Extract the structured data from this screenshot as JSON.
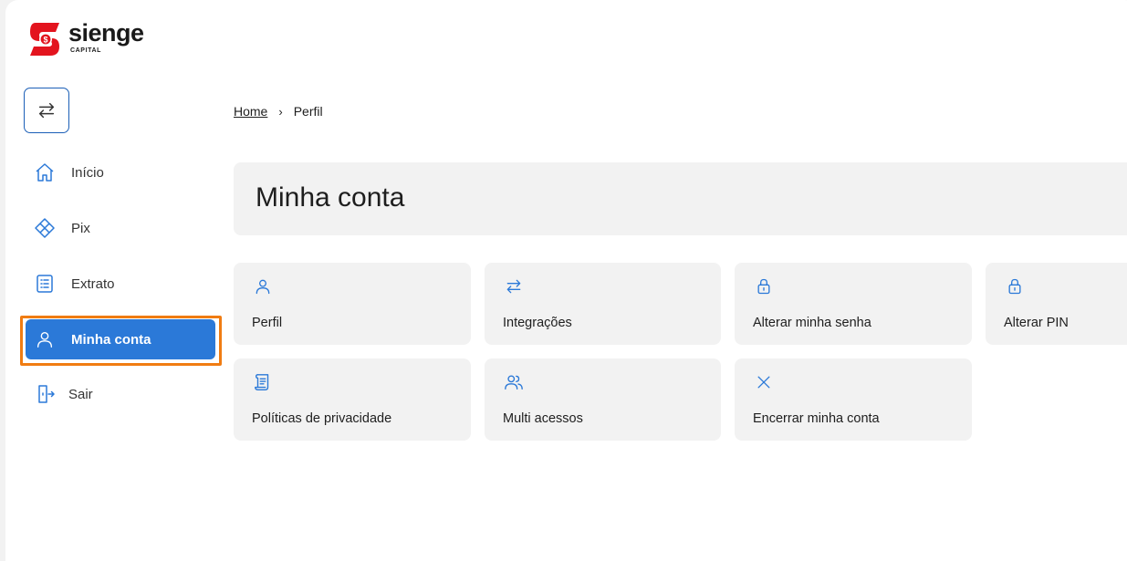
{
  "brand": {
    "name": "sienge",
    "sub": "CAPITAL",
    "color": "#e3141e"
  },
  "colors": {
    "accent": "#2b79d8",
    "highlight": "#f07c12"
  },
  "sidebar": {
    "items": [
      {
        "label": "Início",
        "icon": "home-icon"
      },
      {
        "label": "Pix",
        "icon": "pix-icon"
      },
      {
        "label": "Extrato",
        "icon": "statement-icon"
      },
      {
        "label": "Minha conta",
        "icon": "user-icon",
        "active": true
      },
      {
        "label": "Sair",
        "icon": "logout-icon"
      }
    ]
  },
  "breadcrumb": {
    "home": "Home",
    "separator": "›",
    "current": "Perfil"
  },
  "page": {
    "title": "Minha conta"
  },
  "cards": [
    {
      "label": "Perfil",
      "icon": "user-icon"
    },
    {
      "label": "Integrações",
      "icon": "swap-icon"
    },
    {
      "label": "Alterar minha senha",
      "icon": "lock-icon"
    },
    {
      "label": "Alterar PIN",
      "icon": "lock-icon"
    },
    {
      "label": "Políticas de privacidade",
      "icon": "document-scroll-icon"
    },
    {
      "label": "Multi acessos",
      "icon": "users-icon"
    },
    {
      "label": "Encerrar minha conta",
      "icon": "close-icon"
    }
  ]
}
